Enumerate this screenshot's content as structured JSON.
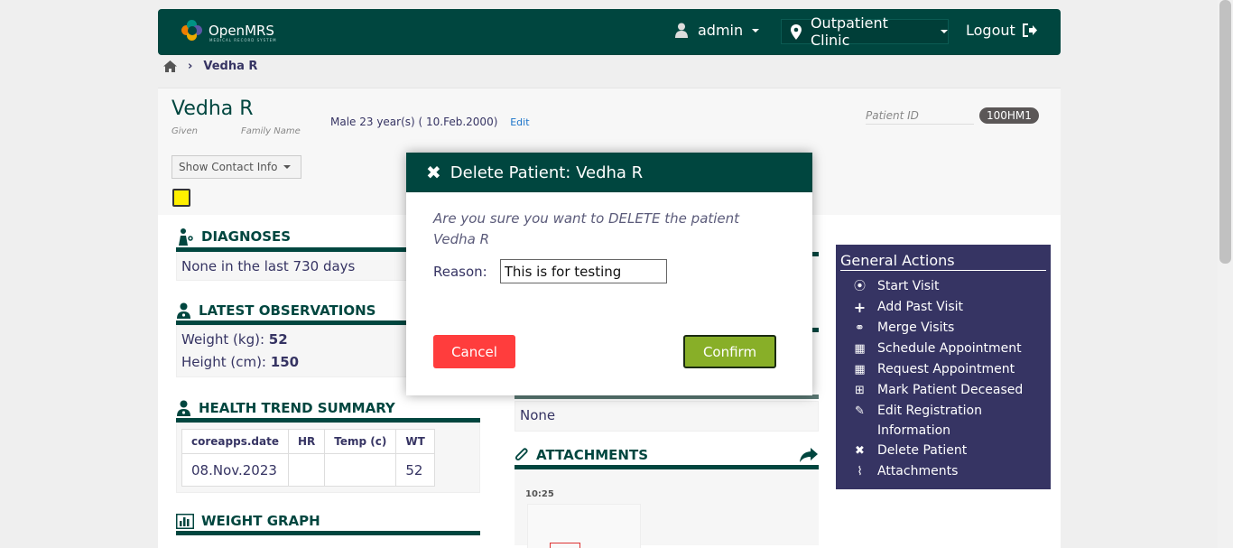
{
  "header": {
    "logo_text": "OpenMRS",
    "logo_subtext": "MEDICAL RECORD SYSTEM",
    "user": "admin",
    "location": "Outpatient Clinic",
    "logout": "Logout"
  },
  "breadcrumb": {
    "patient": "Vedha R"
  },
  "patient": {
    "name": "Vedha R",
    "given_label": "Given",
    "family_label": "Family Name",
    "demographics": "Male  23 year(s) ( 10.Feb.2000)",
    "edit": "Edit",
    "id_label": "Patient ID",
    "id_value": "100HM1",
    "show_contact": "Show Contact Info"
  },
  "diagnoses": {
    "title": "DIAGNOSES",
    "body": "None in the last 730 days"
  },
  "observations": {
    "title": "LATEST OBSERVATIONS",
    "weight_label": "Weight (kg):",
    "weight_value": "52",
    "height_label": "Height (cm):",
    "height_value": "150"
  },
  "trend": {
    "title": "HEALTH TREND SUMMARY",
    "headers": [
      "coreapps.date",
      "HR",
      "Temp (c)",
      "WT"
    ],
    "row": [
      "08.Nov.2023",
      "",
      "",
      "52"
    ]
  },
  "weight_graph": {
    "title": "WEIGHT GRAPH"
  },
  "middle": {
    "none": "None"
  },
  "attachments": {
    "title": "ATTACHMENTS",
    "time": "10:25"
  },
  "actions": {
    "title": "General Actions",
    "items": [
      {
        "label": "Start Visit",
        "icon": "map-pin-icon"
      },
      {
        "label": "Add Past Visit",
        "icon": "plus-icon"
      },
      {
        "label": "Merge Visits",
        "icon": "link-icon"
      },
      {
        "label": "Schedule Appointment",
        "icon": "calendar-icon"
      },
      {
        "label": "Request Appointment",
        "icon": "calendar-icon"
      },
      {
        "label": "Mark Patient Deceased",
        "icon": "plus-square-icon"
      },
      {
        "label": "Edit Registration Information",
        "icon": "pencil-icon"
      },
      {
        "label": "Delete Patient",
        "icon": "x-icon"
      },
      {
        "label": "Attachments",
        "icon": "paperclip-icon"
      }
    ]
  },
  "modal": {
    "title": "Delete Patient: Vedha R",
    "question": "Are you sure you want to DELETE the patient Vedha R",
    "reason_label": "Reason:",
    "reason_value": "This is for testing",
    "cancel": "Cancel",
    "confirm": "Confirm"
  },
  "colors": {
    "brand": "#00463f",
    "sidebar": "#363463",
    "cancel": "#ff3d3d",
    "confirm": "#88af28"
  }
}
